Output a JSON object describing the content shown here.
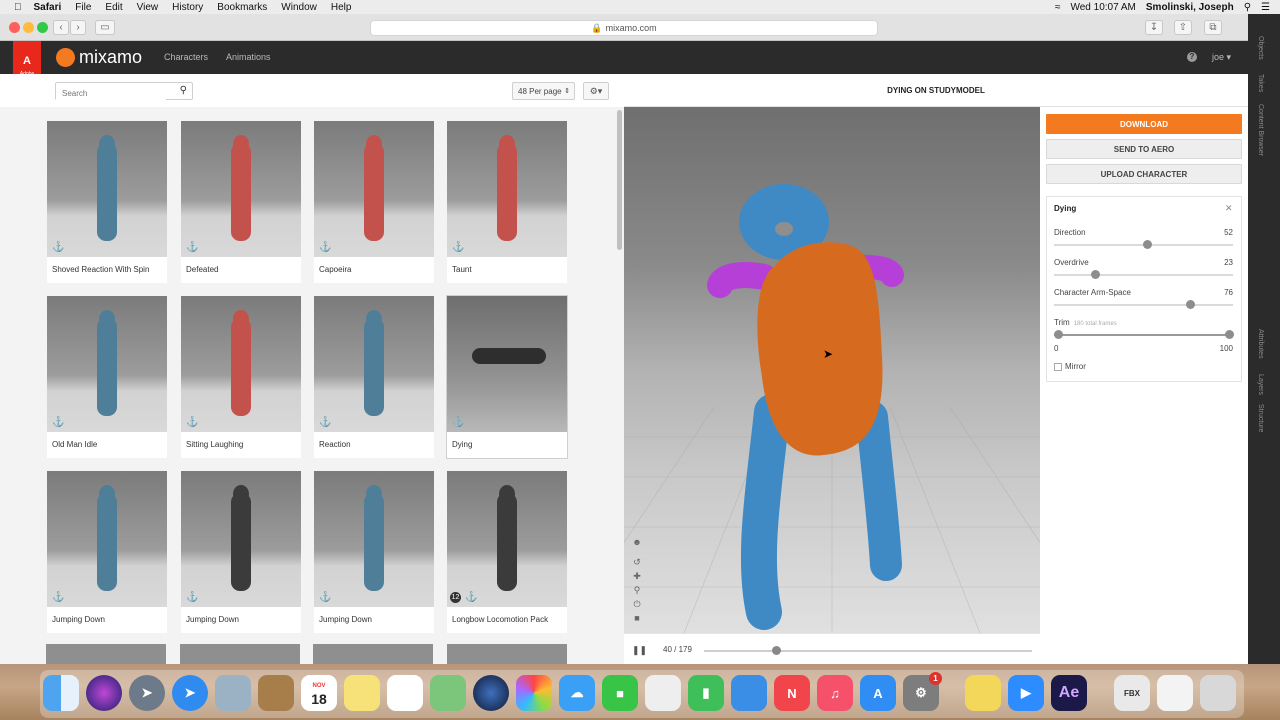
{
  "menubar": {
    "apple": "",
    "items": [
      "Safari",
      "File",
      "Edit",
      "View",
      "History",
      "Bookmarks",
      "Window",
      "Help"
    ],
    "clock": "Wed 10:07 AM",
    "user": "Smolinski, Joseph"
  },
  "browser": {
    "url": "mixamo.com"
  },
  "side_strip": {
    "labels": [
      "Objects",
      "Takes",
      "Content Browser",
      "Attributes",
      "Layers",
      "Structure"
    ]
  },
  "app": {
    "adobe_label": "Adobe",
    "logo_text": "mixamo",
    "nav": [
      "Characters",
      "Animations"
    ],
    "user_menu": "joe",
    "help_icon": "question-icon"
  },
  "library": {
    "search_placeholder": "Search",
    "per_page": "48 Per page",
    "cards": [
      {
        "name": "Shoved Reaction With Spin",
        "color": "#4f7f98"
      },
      {
        "name": "Defeated",
        "color": "#c4524c"
      },
      {
        "name": "Capoeira",
        "color": "#c4524c"
      },
      {
        "name": "Taunt",
        "color": "#c4524c"
      },
      {
        "name": "Old Man Idle",
        "color": "#4f7f98"
      },
      {
        "name": "Sitting Laughing",
        "color": "#c4524c"
      },
      {
        "name": "Reaction",
        "color": "#4f7f98"
      },
      {
        "name": "Dying",
        "color": "#2e2e2e"
      },
      {
        "name": "Jumping Down",
        "color": "#4f7f98"
      },
      {
        "name": "Jumping Down",
        "color": "#3b3b3b"
      },
      {
        "name": "Jumping Down",
        "color": "#4f7f98"
      },
      {
        "name": "Longbow Locomotion Pack",
        "color": "#3b3b3b",
        "pack_count": "12"
      }
    ]
  },
  "viewer": {
    "title": "DYING ON STUDYMODEL",
    "frame_current": "40",
    "frame_total": "179",
    "frame_label": "40 / 179",
    "progress": 0.22
  },
  "actions": {
    "download": "DOWNLOAD",
    "send_to_aero": "SEND TO AERO",
    "upload_character": "UPLOAD CHARACTER"
  },
  "params": {
    "animation_name": "Dying",
    "sliders": [
      {
        "label": "Direction",
        "value": "52",
        "fraction": 0.52
      },
      {
        "label": "Overdrive",
        "value": "23",
        "fraction": 0.23
      },
      {
        "label": "Character Arm-Space",
        "value": "76",
        "fraction": 0.76
      }
    ],
    "trim": {
      "label": "Trim",
      "sublabel": "180 total frames",
      "min": "0",
      "max": "100"
    },
    "mirror": "Mirror"
  },
  "dock": {
    "calendar_month": "NOV",
    "calendar_day": "18",
    "badge": "1",
    "ae_label": "Ae",
    "fbx_label": "FBX"
  },
  "colors": {
    "accent": "#f47a20",
    "adobe_red": "#e8281b",
    "model_blue": "#3f8ac4",
    "model_orange": "#d66b1f",
    "model_purple": "#b63fd7"
  }
}
